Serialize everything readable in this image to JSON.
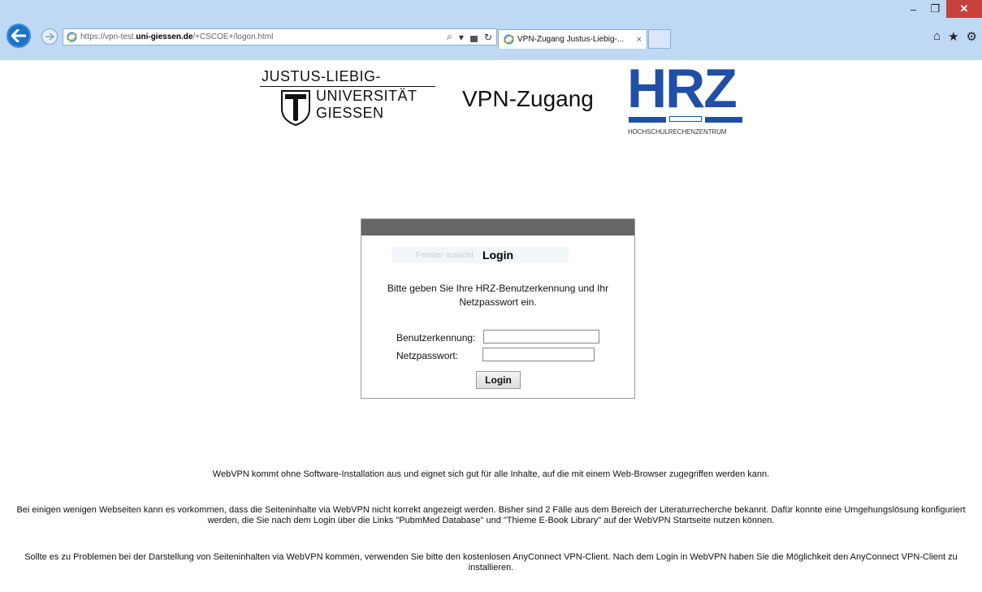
{
  "browser": {
    "url_host_prefix": "https://vpn-test.",
    "url_host": "uni-giessen.de",
    "url_path": "/+CSCOE+/logon.html",
    "tab_title": "VPN-Zugang Justus-Liebig-...",
    "tab_close": "×",
    "window_buttons": {
      "minimize": "–",
      "restore": "❐",
      "close": "✕"
    },
    "addr_tools": {
      "search": "⌕",
      "dropdown": "▾",
      "lock": "🔒",
      "refresh": "↻"
    },
    "right_tools": {
      "home": "⌂",
      "favorites": "★",
      "settings": "⚙"
    }
  },
  "header": {
    "jlu_line1": "JUSTUS-LIEBIG-",
    "jlu_line2": "UNIVERSITÄT",
    "jlu_line3": "GIESSEN",
    "title": "VPN-Zugang",
    "hrz_logo": "HRZ",
    "hrz_subtitle": "HOCHSCHULRECHENZENTRUM",
    "brand_color": "#1f4fa6"
  },
  "login": {
    "ghost_text": "Fenster ausschl",
    "title": "Login",
    "intro": "Bitte geben Sie Ihre HRZ-Benutzerkennung und Ihr Netzpasswort ein.",
    "username_label": "Benutzerkennung:",
    "username_value": "",
    "password_label": "Netzpasswort:",
    "password_value": "",
    "button_label": "Login"
  },
  "info": {
    "p1": "WebVPN kommt ohne Software-Installation aus und eignet sich gut für alle Inhalte, auf die mit einem Web-Browser zugegriffen werden kann.",
    "p2": "Bei einigen wenigen Webseiten kann es vorkommen, dass die Seiteninhalte via WebVPN nicht korrekt angezeigt werden. Bisher sind 2 Fälle aus dem Bereich der Literaturrecherche bekannt. Dafür konnte eine Umgehungslösung konfiguriert werden, die Sie nach dem Login über die Links \"PubmMed Database\" und \"Thieme E-Book Library\" auf der WebVPN Startseite nutzen können.",
    "p3": "Sollte es zu Problemen bei der Darstellung von Seiteninhalten via WebVPN kommen, verwenden Sie bitte den kostenlosen AnyConnect VPN-Client. Nach dem Login in WebVPN haben Sie die Möglichkeit den AnyConnect VPN-Client zu installieren."
  }
}
